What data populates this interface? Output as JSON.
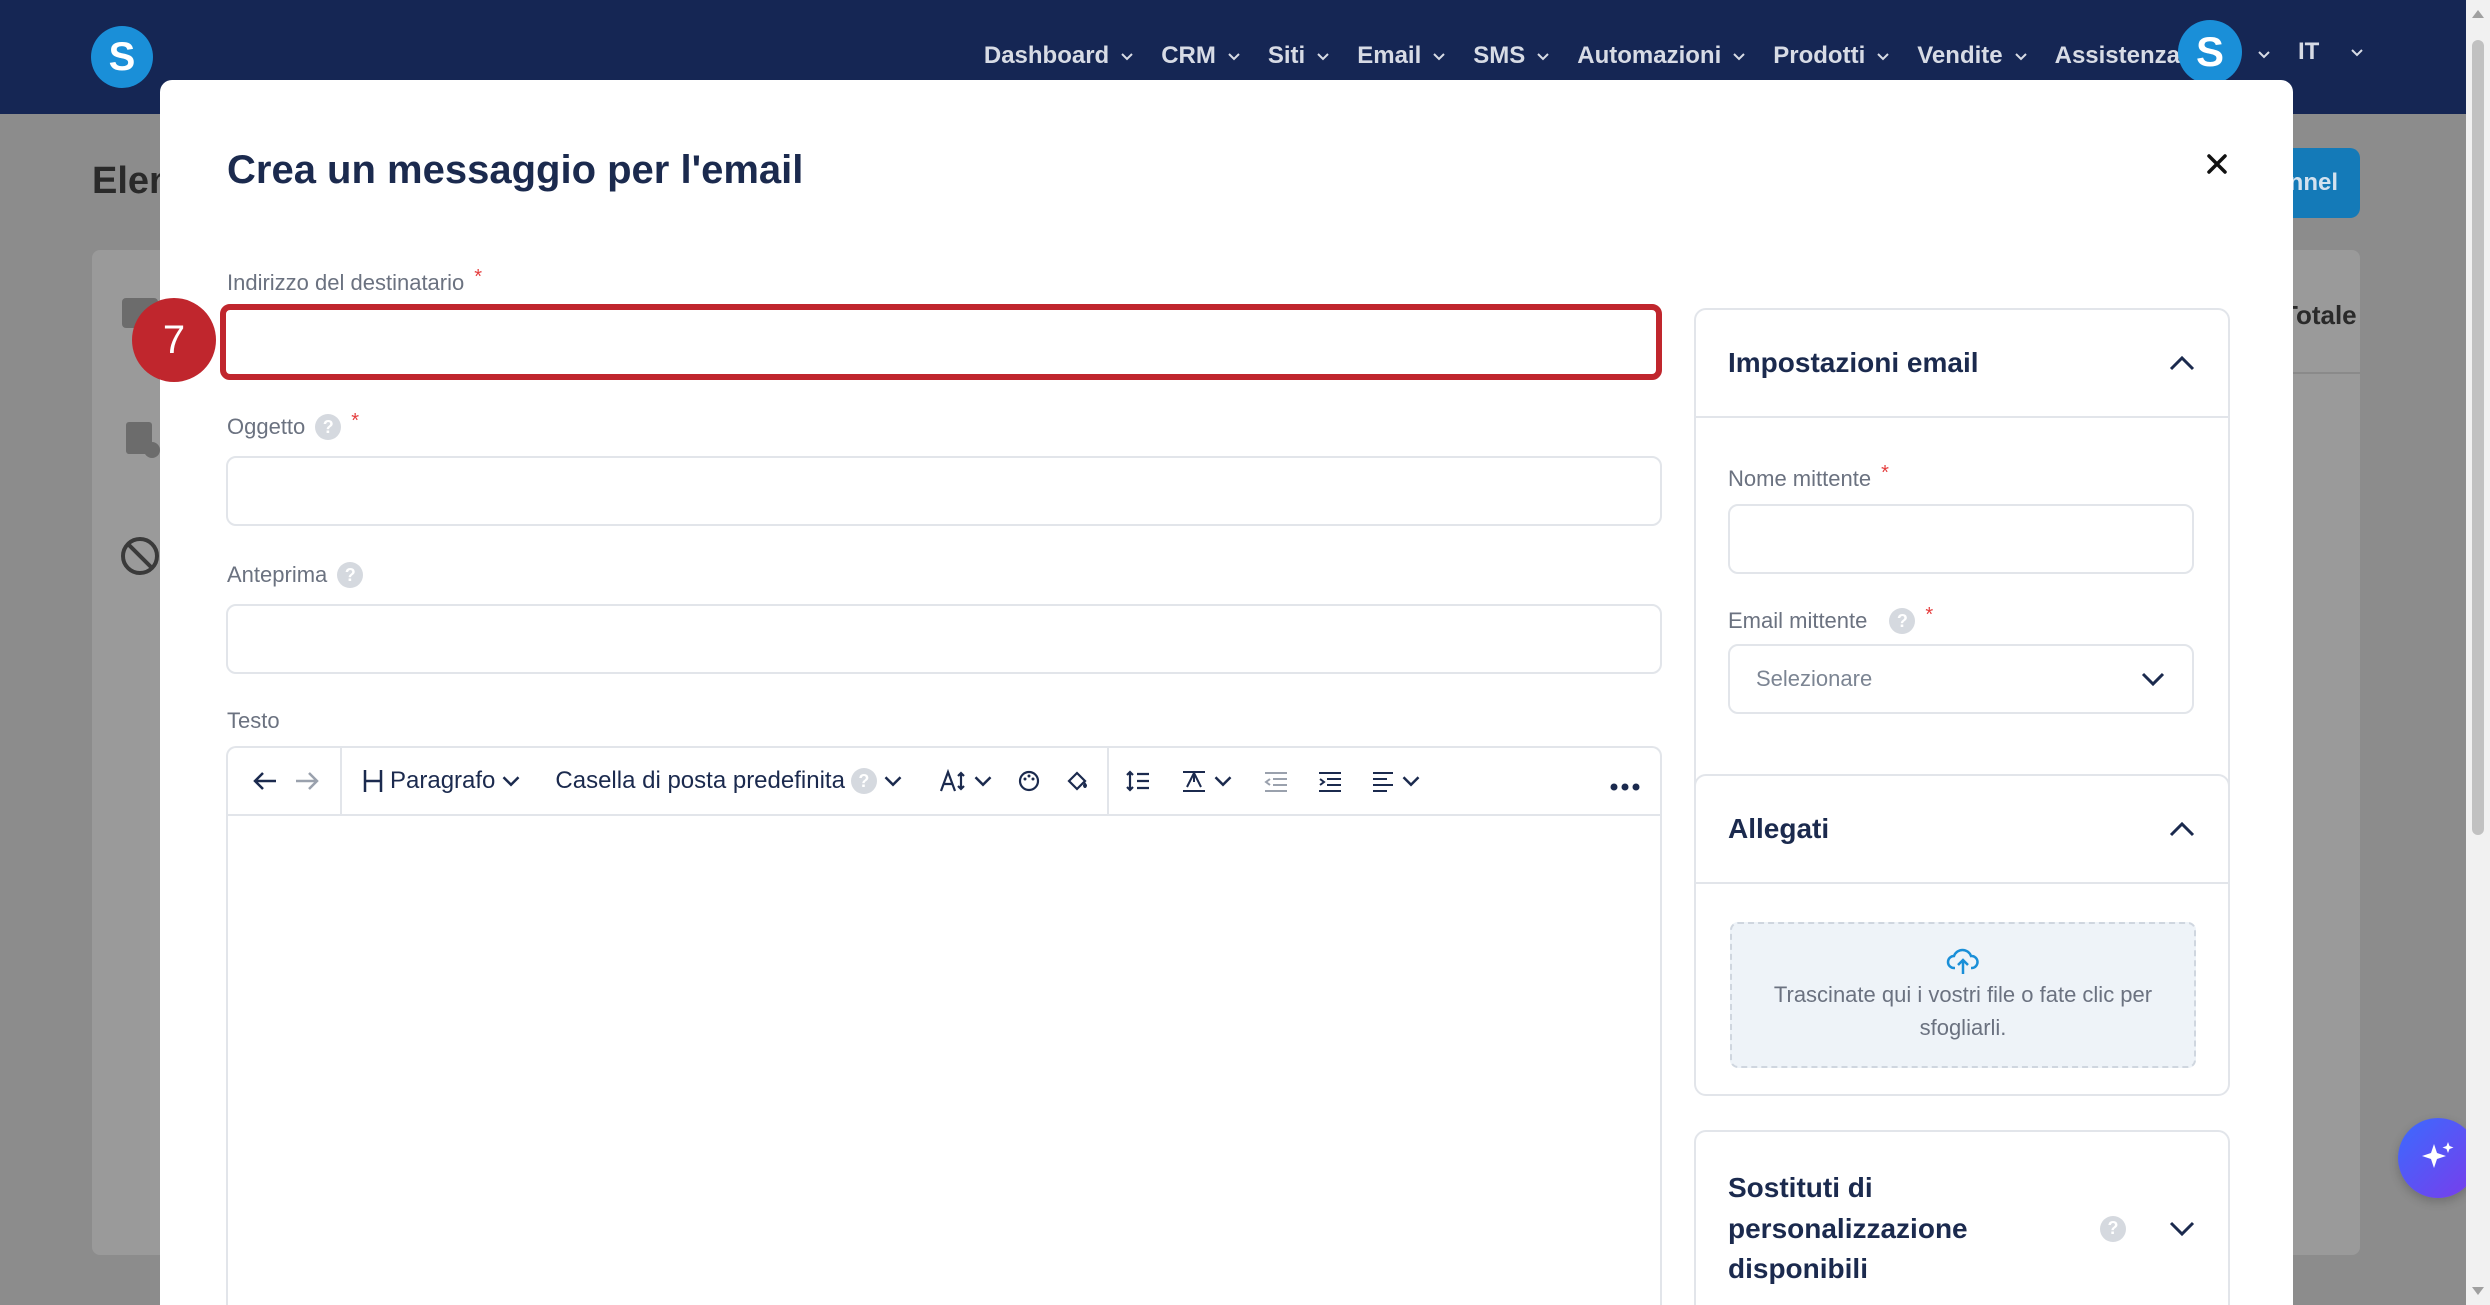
{
  "navbar": {
    "logo_letter": "S",
    "items": [
      {
        "label": "Dashboard"
      },
      {
        "label": "CRM"
      },
      {
        "label": "Siti"
      },
      {
        "label": "Email"
      },
      {
        "label": "SMS"
      },
      {
        "label": "Automazioni"
      },
      {
        "label": "Prodotti"
      },
      {
        "label": "Vendite"
      },
      {
        "label": "Assistenza"
      }
    ],
    "avatar_letter": "S",
    "language": "IT"
  },
  "background": {
    "title_fragment": "Elen",
    "button_fragment": "nnel",
    "column_fragment": "Totale"
  },
  "modal": {
    "title": "Crea un messaggio per l'email",
    "recipient": {
      "label": "Indirizzo del destinatario",
      "required": "*",
      "value": ""
    },
    "subject": {
      "label": "Oggetto",
      "required": "*",
      "value": ""
    },
    "preview": {
      "label": "Anteprima",
      "value": ""
    },
    "body": {
      "label": "Testo",
      "toolbar": {
        "heading_label": "Paragrafo",
        "mailbox_label": "Casella di posta predefinita"
      }
    },
    "step_number": "7"
  },
  "email_settings": {
    "title": "Impostazioni email",
    "sender_name": {
      "label": "Nome mittente",
      "required": "*",
      "value": ""
    },
    "sender_email": {
      "label": "Email mittente",
      "required": "*",
      "placeholder": "Selezionare"
    }
  },
  "attachments": {
    "title": "Allegati",
    "dropzone_text": "Trascinate qui i vostri file o fate clic per sfogliarli."
  },
  "personalization": {
    "title": "Sostituti di personalizzazione disponibili"
  },
  "colors": {
    "navbar": "#152654",
    "brand_blue": "#1a8fd8",
    "highlight_red": "#c0262d",
    "required_red": "#e53e3e",
    "title_navy": "#1b2a4e"
  }
}
